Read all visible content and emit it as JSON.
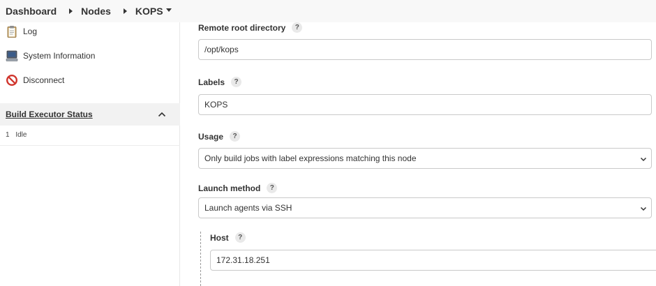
{
  "breadcrumb": {
    "items": [
      "Dashboard",
      "Nodes",
      "KOPS"
    ]
  },
  "sidebar": {
    "items": [
      {
        "label": "Log",
        "icon": "clipboard-icon"
      },
      {
        "label": "System Information",
        "icon": "computer-icon"
      },
      {
        "label": "Disconnect",
        "icon": "no-entry-icon"
      }
    ],
    "executor_status": {
      "title": "Build Executor Status",
      "rows": [
        {
          "number": "1",
          "status": "Idle"
        }
      ]
    }
  },
  "form": {
    "remote_root": {
      "label": "Remote root directory",
      "help": "?",
      "value": "/opt/kops"
    },
    "labels": {
      "label": "Labels",
      "help": "?",
      "value": "KOPS"
    },
    "usage": {
      "label": "Usage",
      "help": "?",
      "value": "Only build jobs with label expressions matching this node"
    },
    "launch_method": {
      "label": "Launch method",
      "help": "?",
      "value": "Launch agents via SSH"
    },
    "host": {
      "label": "Host",
      "help": "?",
      "value": "172.31.18.251"
    }
  },
  "colors": {
    "topbar_bg": "#f8f8f8",
    "section_bg": "#f2f2f2",
    "field_border": "#c9c9c9",
    "disconnect_red": "#d0342c"
  }
}
